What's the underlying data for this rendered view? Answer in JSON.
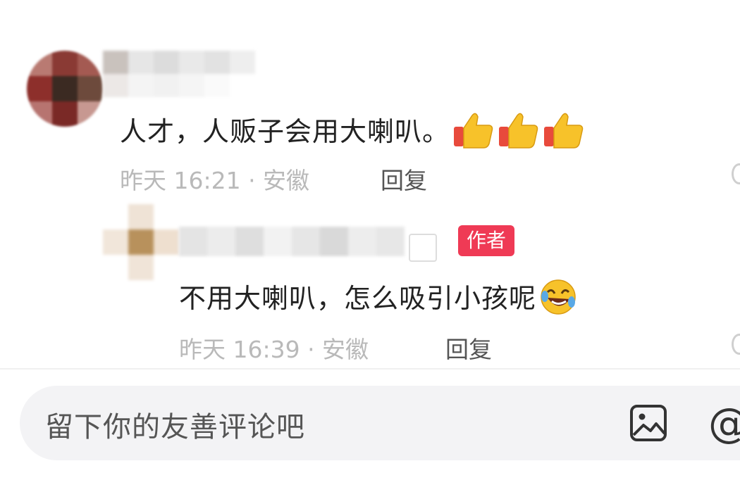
{
  "comments": [
    {
      "text": "人才，人贩子会用大喇叭。",
      "emoji": "thumbs-up-icon ×3",
      "time": "昨天 16:21",
      "location": "安徽",
      "meta": "昨天 16:21 · 安徽",
      "reply_label": "回复"
    },
    {
      "text": "不用大喇叭，怎么吸引小孩呢",
      "emoji": "rolling-on-floor-laughing-icon",
      "badge": "作者",
      "time": "昨天 16:39",
      "location": "安徽",
      "meta": "昨天 16:39 · 安徽",
      "reply_label": "回复"
    }
  ],
  "input": {
    "placeholder": "留下你的友善评论吧"
  },
  "icons": {
    "image": "image-icon",
    "mention": "at-icon",
    "mention_glyph": "@"
  },
  "colors": {
    "badge": "#ef3a55",
    "meta_text": "#b9b9b9",
    "body_text": "#222222",
    "input_bg": "#f3f3f5"
  }
}
